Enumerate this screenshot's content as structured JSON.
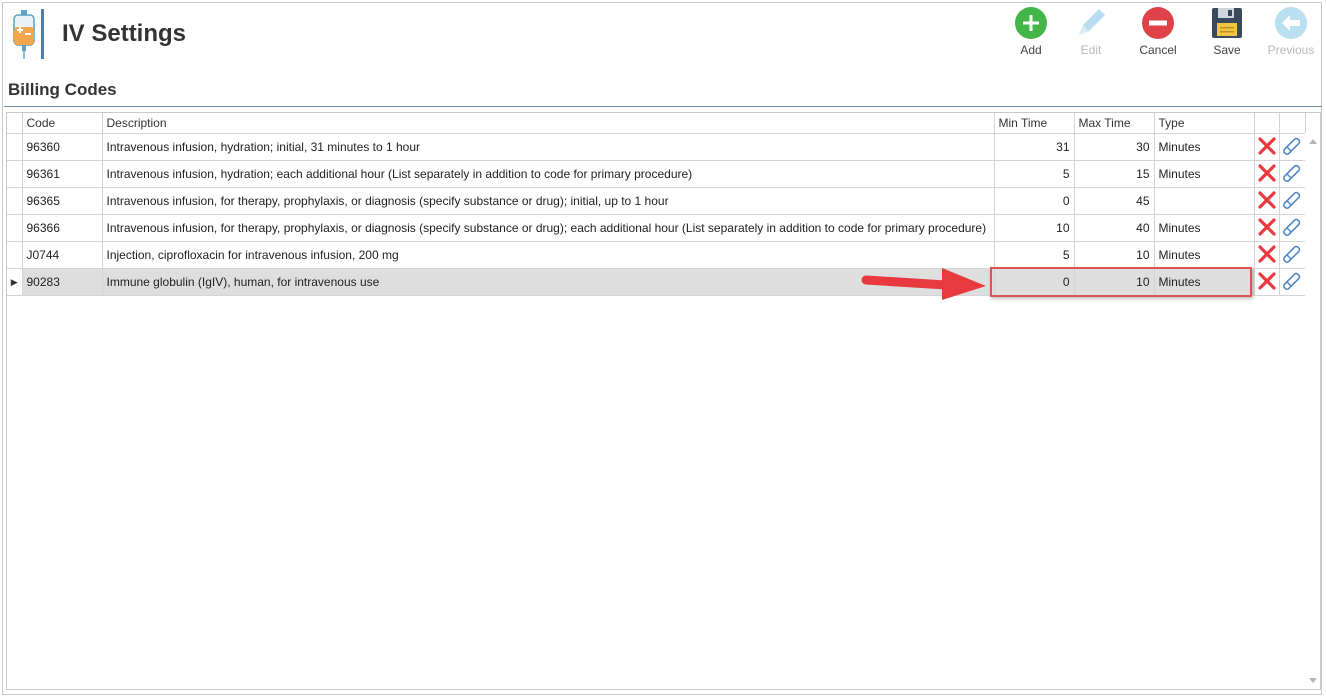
{
  "header": {
    "title": "IV Settings"
  },
  "toolbar": {
    "add_label": "Add",
    "edit_label": "Edit",
    "cancel_label": "Cancel",
    "save_label": "Save",
    "previous_label": "Previous"
  },
  "section": {
    "title": "Billing Codes"
  },
  "grid": {
    "columns": {
      "code": "Code",
      "description": "Description",
      "min_time": "Min Time",
      "max_time": "Max Time",
      "type": "Type"
    },
    "rows": [
      {
        "code": "96360",
        "description": "Intravenous infusion, hydration; initial, 31 minutes to 1 hour",
        "min": "31",
        "max": "30",
        "type": "Minutes"
      },
      {
        "code": "96361",
        "description": "Intravenous infusion, hydration; each additional hour (List separately in addition to code for primary procedure)",
        "min": "5",
        "max": "15",
        "type": "Minutes"
      },
      {
        "code": "96365",
        "description": "Intravenous infusion, for therapy, prophylaxis, or diagnosis (specify substance or drug); initial, up to 1 hour",
        "min": "0",
        "max": "45",
        "type": ""
      },
      {
        "code": "96366",
        "description": "Intravenous infusion, for therapy, prophylaxis, or diagnosis (specify substance or drug); each additional hour (List separately in addition to code for primary procedure)",
        "min": "10",
        "max": "40",
        "type": "Minutes"
      },
      {
        "code": "J0744",
        "description": "Injection, ciprofloxacin for intravenous infusion, 200 mg",
        "min": "5",
        "max": "10",
        "type": "Minutes"
      },
      {
        "code": "90283",
        "description": "Immune globulin (IgIV), human, for intravenous use",
        "min": "0",
        "max": "10",
        "type": "Minutes"
      }
    ],
    "selected_row_indicator": "▶"
  },
  "icons": {
    "delete": "delete-x-icon",
    "edit_row": "pencil-edit-icon"
  },
  "colors": {
    "add": "#43b649",
    "cancel": "#e0424a",
    "save": "#3a4a5c",
    "delete": "#e8393f",
    "edit_row": "#4f86c6",
    "highlight": "#e05353",
    "selected_row": "#dedede"
  }
}
